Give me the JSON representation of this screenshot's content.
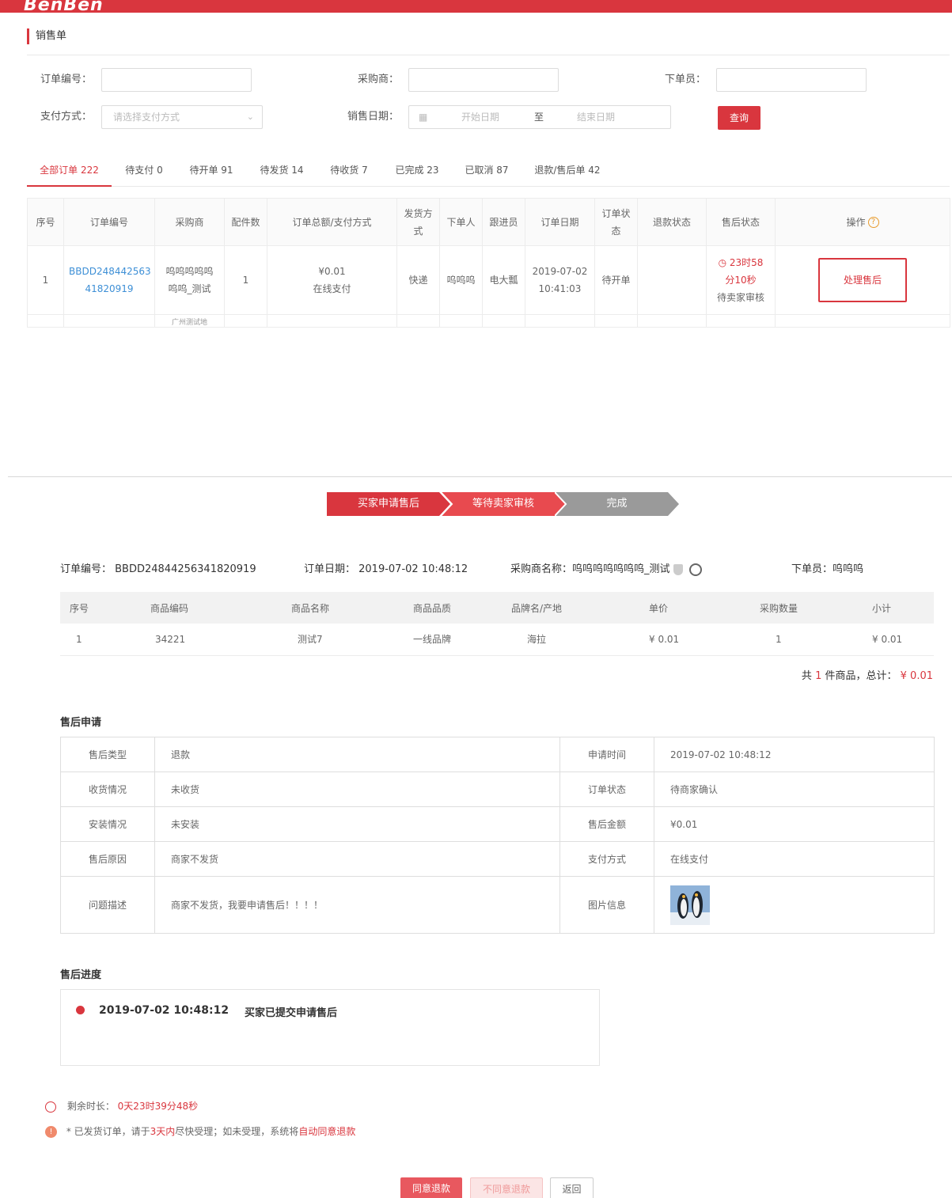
{
  "brand": {
    "logo_text": "BenBen"
  },
  "page": {
    "section_title": "销售单"
  },
  "filters": {
    "order_no_label": "订单编号：",
    "purchaser_label": "采购商：",
    "orderer_label": "下单员：",
    "payment_label": "支付方式：",
    "payment_placeholder": "请选择支付方式",
    "sale_date_label": "销售日期：",
    "start_placeholder": "开始日期",
    "to_text": "至",
    "end_placeholder": "结束日期",
    "query_label": "查询"
  },
  "tabs": [
    {
      "label": "全部订单 222",
      "active": true
    },
    {
      "label": "待支付 0"
    },
    {
      "label": "待开单 91"
    },
    {
      "label": "待发货 14"
    },
    {
      "label": "待收货 7"
    },
    {
      "label": "已完成 23"
    },
    {
      "label": "已取消 87"
    },
    {
      "label": "退款/售后单 42"
    }
  ],
  "order_table": {
    "headers": [
      "序号",
      "订单编号",
      "采购商",
      "配件数",
      "订单总额/支付方式",
      "发货方式",
      "下单人",
      "跟进员",
      "订单日期",
      "订单状态",
      "退款状态",
      "售后状态",
      "操作"
    ],
    "help_icon": "?",
    "row": {
      "index": "1",
      "order_no_1": "BBDD248442563",
      "order_no_2": "41820919",
      "purchaser_1": "呜呜呜呜呜",
      "purchaser_2": "呜呜_测试",
      "parts": "1",
      "amount": "¥0.01",
      "pay_method": "在线支付",
      "ship": "快递",
      "orderer": "呜呜呜",
      "follower": "电大瓢",
      "date_1": "2019-07-02",
      "date_2": "10:41:03",
      "status": "待开单",
      "refund_status": "",
      "countdown_1": "23时58",
      "countdown_2": "分10秒",
      "after_status": "待卖家审核",
      "action": "处理售后"
    },
    "next_row_peek": "广州测试地"
  },
  "steps": [
    "买家申请售后",
    "等待卖家审核",
    "完成"
  ],
  "order_info": {
    "order_no": "订单编号： BBDD24844256341820919",
    "order_date": "订单日期： 2019-07-02 10:48:12",
    "purchaser": "采购商名称：呜呜呜呜呜呜呜_测试",
    "orderer": "下单员：呜呜呜"
  },
  "product_table": {
    "headers": [
      "序号",
      "商品编码",
      "商品名称",
      "商品品质",
      "品牌名/产地",
      "单价",
      "采购数量",
      "小计"
    ],
    "row": [
      "1",
      "34221",
      "测试7",
      "一线品牌",
      "海拉",
      "¥ 0.01",
      "1",
      "¥ 0.01"
    ]
  },
  "total": {
    "prefix": "共",
    "count": "1",
    "mid": "件商品，总计：",
    "amount": "¥ 0.01"
  },
  "after_sale": {
    "title": "售后申请",
    "rows": [
      {
        "l1": "售后类型",
        "v1": "退款",
        "l2": "申请时间",
        "v2": "2019-07-02 10:48:12"
      },
      {
        "l1": "收货情况",
        "v1": "未收货",
        "l2": "订单状态",
        "v2": "待商家确认"
      },
      {
        "l1": "安装情况",
        "v1": "未安装",
        "l2": "售后金额",
        "v2": "¥0.01"
      },
      {
        "l1": "售后原因",
        "v1": "商家不发货",
        "l2": "支付方式",
        "v2": "在线支付"
      },
      {
        "l1": "问题描述",
        "v1": "商家不发货，我要申请售后！！！！",
        "l2": "图片信息",
        "v2": ""
      }
    ]
  },
  "progress": {
    "title": "售后进度",
    "time": "2019-07-02 10:48:12",
    "text": "买家已提交申请售后"
  },
  "notes": {
    "remain_label": "剩余时长：",
    "remain_value": "0天23时39分48秒",
    "tip_prefix": "* 已发货订单，请于",
    "tip_days": "3天内",
    "tip_mid": "尽快受理；如未受理，系统将",
    "tip_action": "自动同意退款"
  },
  "actions": {
    "agree": "同意退款",
    "disagree": "不同意退款",
    "back": "返回"
  },
  "colors": {
    "primary": "#d9363e",
    "link": "#3d8fd6",
    "price": "#e0712a",
    "step_done": "#d9363e",
    "step_todo": "#9a9a9a"
  }
}
